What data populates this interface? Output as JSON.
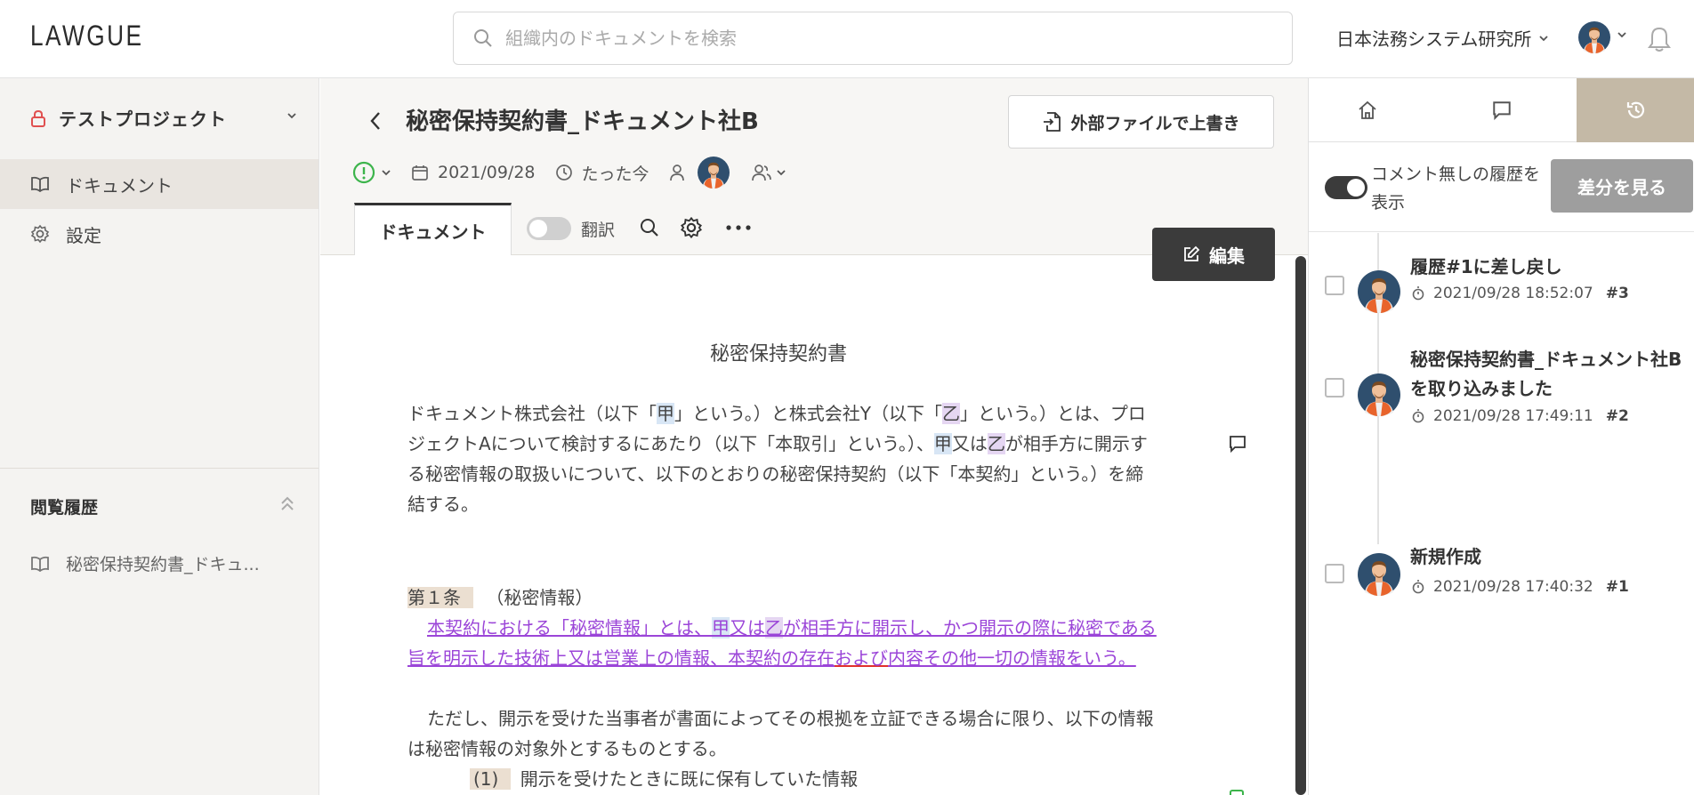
{
  "header": {
    "logo": "LAWGUE",
    "search_placeholder": "組織内のドキュメントを検索",
    "org_name": "日本法務システム研究所"
  },
  "sidebar": {
    "project_name": "テストプロジェクト",
    "nav": [
      {
        "label": "ドキュメント",
        "icon": "book-icon",
        "active": true
      },
      {
        "label": "設定",
        "icon": "gear-icon",
        "active": false
      }
    ],
    "history_title": "閲覧履歴",
    "history_items": [
      "秘密保持契約書_ドキュ..."
    ]
  },
  "document": {
    "title": "秘密保持契約書_ドキュメント社B",
    "overwrite_label": "外部ファイルで上書き",
    "date": "2021/09/28",
    "updated": "たった今",
    "tab_label": "ドキュメント",
    "translate_label": "翻訳",
    "edit_label": "編集",
    "content": {
      "heading": "秘密保持契約書",
      "preamble": {
        "a": "ドキュメント株式会社（以下「",
        "ko": "甲",
        "b": "」という。）と株式会社Y（以下「",
        "otsu": "乙",
        "c": "」という。）とは、プロジェクトAについて検討するにあたり（以下「本取引」という。）、",
        "ko2": "甲",
        "d": "又は",
        "otsu2": "乙",
        "e": "が相手方に開示する秘密情報の取扱いについて、以下のとおりの秘密保持契約（以下「本契約」という。）を締結する。"
      },
      "article1_label": "第１条",
      "article1_title": "（秘密情報）",
      "article1_p1": {
        "a": "本契約における「秘密情報」とは、",
        "ko": "甲",
        "b": "又は",
        "otsu": "乙",
        "c": "が相手方に開示し、かつ開示の際に秘密である旨を明示した技術上又は営業上の情報、本契約の存在",
        "and": "および",
        "d": "内容その他一切の情報をいう。"
      },
      "article1_p2": "ただし、開示を受けた当事者が書面によってその根拠を立証できる場合に限り、以下の情報は秘密情報の対象外とするものとする。",
      "item1_num": "(1)",
      "item1_text": "開示を受けたときに既に保有していた情報"
    }
  },
  "right_panel": {
    "tabs": [
      "home-icon",
      "comment-icon",
      "history-icon"
    ],
    "show_label": "コメント無しの履歴を表示",
    "diff_label": "差分を見る",
    "entries": [
      {
        "title": "履歴#1に差し戻し",
        "time": "2021/09/28 18:52:07",
        "ver": "#3"
      },
      {
        "title": "秘密保持契約書_ドキュメント社Bを取り込みました",
        "time": "2021/09/28 17:49:11",
        "ver": "#2"
      },
      {
        "title": "新規作成",
        "time": "2021/09/28 17:40:32",
        "ver": "#1"
      }
    ]
  }
}
